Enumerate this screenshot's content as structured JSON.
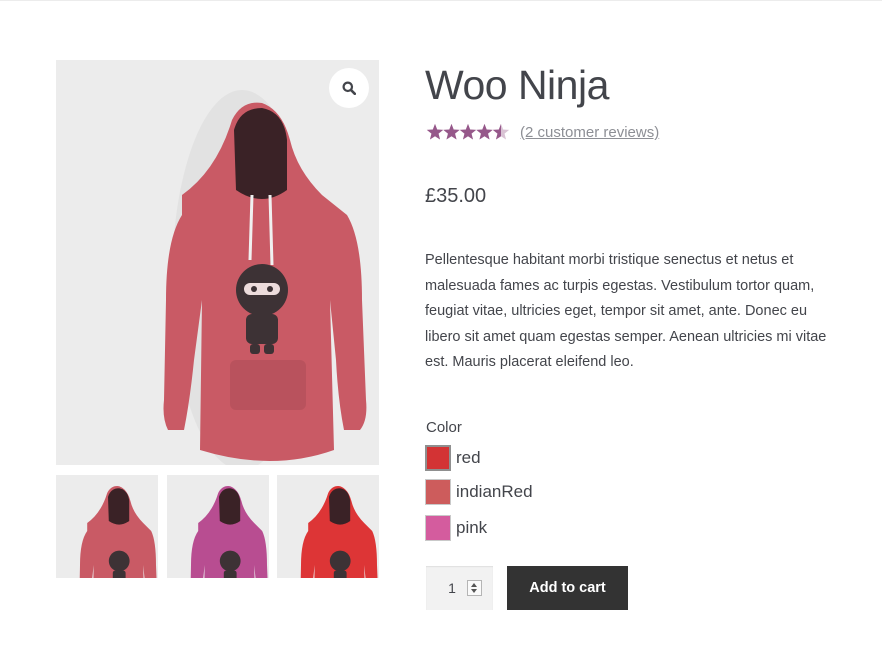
{
  "product": {
    "title": "Woo Ninja",
    "rating": 4.5,
    "rating_max": 5,
    "reviews_link": "(2 customer reviews)",
    "price": "£35.00",
    "description": "Pellentesque habitant morbi tristique senectus et netus et malesuada fames ac turpis egestas. Vestibulum tortor quam, feugiat vitae, ultricies eget, tempor sit amet, ante. Donec eu libero sit amet quam egestas semper. Aenean ultricies mi vitae est. Mauris placerat eleifend leo."
  },
  "gallery": {
    "zoom_icon": "magnifier-icon",
    "main_image": {
      "subject": "hoodie",
      "color": "#c95a65"
    },
    "thumbnails": [
      {
        "subject": "hoodie",
        "color": "#c95a65"
      },
      {
        "subject": "hoodie",
        "color": "#b84d91"
      },
      {
        "subject": "hoodie",
        "color": "#dd3536"
      }
    ]
  },
  "variations": {
    "label": "Color",
    "options": [
      {
        "name": "red",
        "hex": "#d33334",
        "selected": true
      },
      {
        "name": "indianRed",
        "hex": "#cd5c5c",
        "selected": false
      },
      {
        "name": "pink",
        "hex": "#d45c9e",
        "selected": false
      }
    ]
  },
  "cart": {
    "quantity": "1",
    "add_to_cart_label": "Add to cart"
  },
  "colors": {
    "star": "#96588a",
    "star_empty": "#d9c3d4",
    "button_bg": "#333333"
  }
}
